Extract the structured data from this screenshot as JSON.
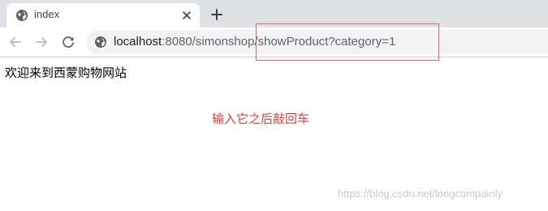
{
  "browser": {
    "tab": {
      "title": "index",
      "favicon": "globe-icon",
      "close_icon": "close-icon"
    },
    "new_tab_icon": "plus-icon",
    "toolbar": {
      "back_icon": "back-arrow-icon",
      "forward_icon": "forward-arrow-icon",
      "reload_icon": "reload-icon",
      "site_info_icon": "globe-icon"
    },
    "url": {
      "host": "localhost",
      "rest": ":8080/simonshop/showProduct?category=1"
    }
  },
  "page": {
    "welcome": "欢迎来到西蒙购物网站"
  },
  "annotation": {
    "text": "输入它之后敲回车",
    "color": "#e03c3c"
  },
  "watermark": "https://blog.csdn.net/longcompainly"
}
